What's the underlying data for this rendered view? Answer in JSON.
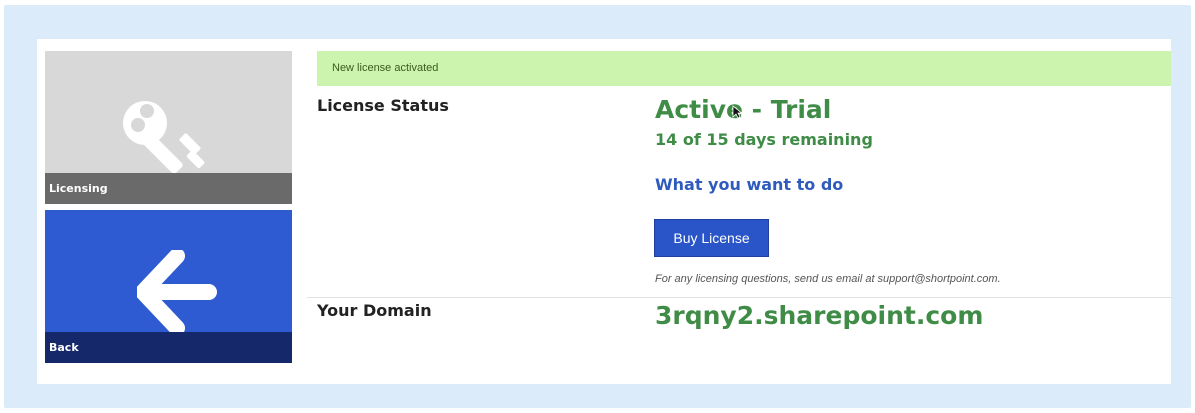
{
  "sidebar": {
    "tiles": [
      {
        "label": "Licensing",
        "icon": "key-icon",
        "color": "#d8d8d8",
        "caption_color": "#6a6a6a"
      },
      {
        "label": "Back",
        "icon": "arrow-left-icon",
        "color": "#2e5bd1",
        "caption_color": "#15296a"
      }
    ]
  },
  "banner": {
    "message": "New license activated",
    "color": "#cdf4ae"
  },
  "license": {
    "status_label": "License Status",
    "status": "Active - Trial",
    "days_remaining": "14 of 15 days remaining",
    "action_heading": "What you want to do",
    "buy_button": "Buy License",
    "help_text": "For any licensing questions, send us email at support@shortpoint.com."
  },
  "domain": {
    "label": "Your Domain",
    "value": "3rqny2.sharepoint.com"
  },
  "colors": {
    "accent_green": "#3f8c46",
    "accent_blue": "#2e5bbd",
    "button_blue": "#2a55c8",
    "frame": "#dcebfa"
  }
}
